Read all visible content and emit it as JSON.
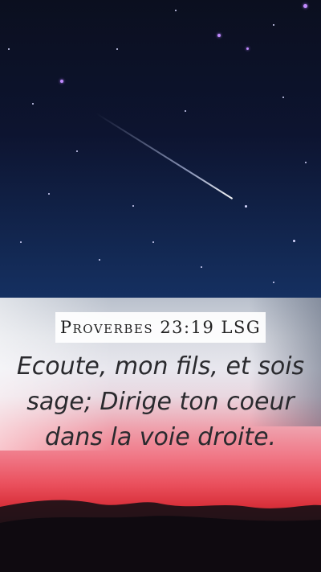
{
  "reference": "Proverbes 23:19 LSG",
  "verse": "Ecoute, mon fils, et sois sage; Dirige ton coeur dans la voie droite.",
  "background": {
    "sky_color": "#0d1430",
    "sunset_colors": [
      "#e8e7ee",
      "#f07786",
      "#d8303a",
      "#120c17"
    ]
  }
}
